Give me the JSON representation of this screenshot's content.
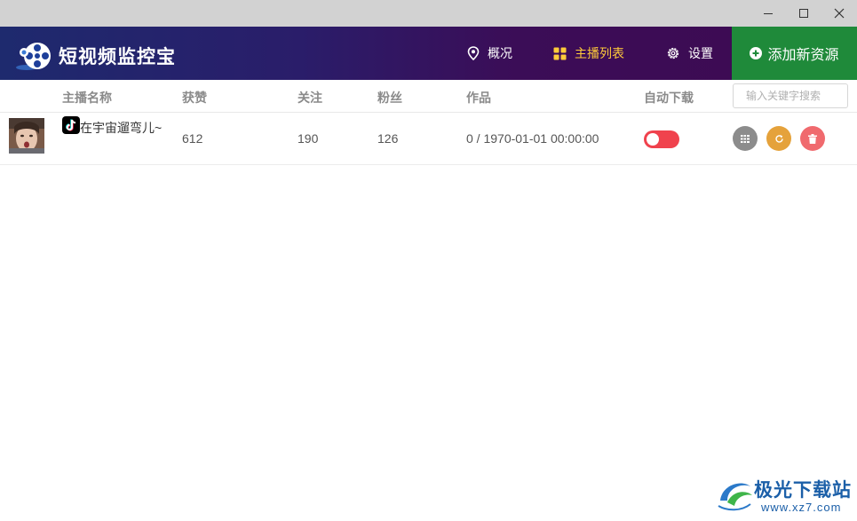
{
  "window": {
    "minimize_label": "Minimize",
    "maximize_label": "Maximize",
    "close_label": "Close"
  },
  "app": {
    "title": "短视频监控宝",
    "accent": "#ffcb3a",
    "header_start": "#1e2a6e",
    "header_end": "#3e0a52"
  },
  "nav": {
    "items": [
      {
        "label": "概况",
        "icon": "location-pin-icon",
        "active": false
      },
      {
        "label": "主播列表",
        "icon": "grid-icon",
        "active": true
      },
      {
        "label": "设置",
        "icon": "gear-icon",
        "active": false
      }
    ],
    "add_button": {
      "label": "添加新资源",
      "icon": "plus-circle-icon",
      "color": "#1f8a3a"
    }
  },
  "table": {
    "columns": [
      "主播名称",
      "获赞",
      "关注",
      "粉丝",
      "作品",
      "自动下载"
    ],
    "search_placeholder": "输入关键字搜索",
    "rows": [
      {
        "platform_icon": "tiktok-icon",
        "name": "在宇宙遛弯儿~",
        "likes": "612",
        "following": "190",
        "fans": "126",
        "works": "0 / 1970-01-01 00:00:00",
        "auto_download": "off",
        "actions": [
          {
            "name": "detail",
            "icon": "list-icon",
            "color": "#8c8c8c"
          },
          {
            "name": "refresh",
            "icon": "refresh-icon",
            "color": "#e5a23b"
          },
          {
            "name": "delete",
            "icon": "trash-icon",
            "color": "#f06a6e"
          }
        ]
      }
    ]
  },
  "watermark": {
    "text": "极光下载站",
    "url": "www.xz7.com"
  }
}
